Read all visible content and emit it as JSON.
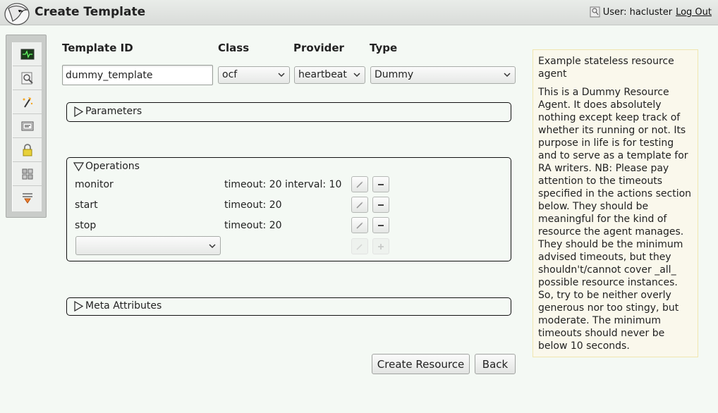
{
  "header": {
    "title": "Create Template",
    "user_label": "User: hacluster",
    "logout_label": "Log Out"
  },
  "sidebar": {
    "items": [
      {
        "icon": "monitor-icon"
      },
      {
        "icon": "magnifier-icon"
      },
      {
        "icon": "wand-icon"
      },
      {
        "icon": "ticket-icon"
      },
      {
        "icon": "lock-icon"
      },
      {
        "icon": "puzzle-icon"
      },
      {
        "icon": "filter-icon"
      }
    ]
  },
  "form": {
    "template_id_label": "Template ID",
    "class_label": "Class",
    "provider_label": "Provider",
    "type_label": "Type",
    "template_id_value": "dummy_template",
    "class_value": "ocf",
    "provider_value": "heartbeat",
    "type_value": "Dummy"
  },
  "sections": {
    "parameters": "Parameters",
    "operations": "Operations",
    "meta_attributes": "Meta Attributes"
  },
  "operations": [
    {
      "name": "monitor",
      "params": "timeout: 20 interval: 10"
    },
    {
      "name": "start",
      "params": "timeout: 20"
    },
    {
      "name": "stop",
      "params": "timeout: 20"
    }
  ],
  "operation_select_value": "",
  "buttons": {
    "create": "Create Resource",
    "back": "Back"
  },
  "help": {
    "summary": "Example stateless resource agent",
    "description": "This is a Dummy Resource Agent. It does absolutely nothing except keep track of whether its running or not. Its purpose in life is for testing and to serve as a template for RA writers. NB: Please pay attention to the timeouts specified in the actions section below. They should be meaningful for the kind of resource the agent manages. They should be the minimum advised timeouts, but they shouldn't/cannot cover _all_ possible resource instances. So, try to be neither overly generous nor too stingy, but moderate. The minimum timeouts should never be below 10 seconds."
  },
  "colors": {
    "background": "#f4f9f4",
    "help_background": "#faf8ec",
    "help_border": "#f0e6b0",
    "header": "#dfe2df"
  }
}
